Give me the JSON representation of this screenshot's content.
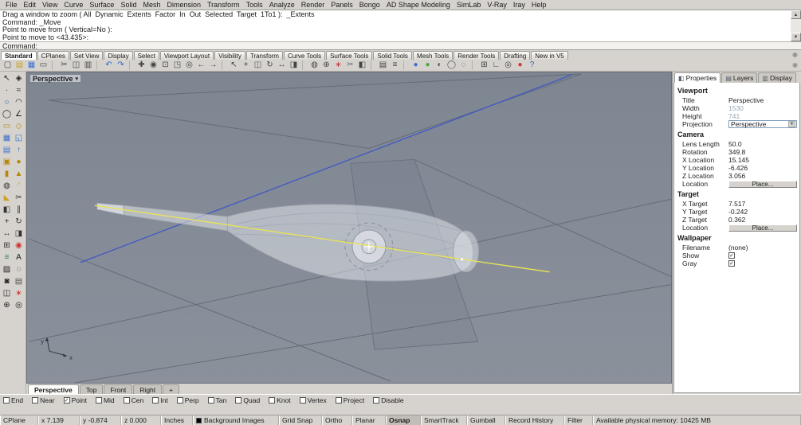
{
  "icons": {
    "dropdown": "▾",
    "check": "✓",
    "scroll_up": "▲",
    "scroll_down": "▼",
    "round_button": "◉"
  },
  "menu_bar": {
    "items": [
      "File",
      "Edit",
      "View",
      "Curve",
      "Surface",
      "Solid",
      "Mesh",
      "Dimension",
      "Transform",
      "Tools",
      "Analyze",
      "Render",
      "Panels",
      "Bongo",
      "AD Shape Modeling",
      "SimLab",
      "V-Ray",
      "Iray",
      "Help"
    ]
  },
  "command_area": {
    "history": [
      "Drag a window to zoom ( All  Dynamic  Extents  Factor  In  Out  Selected  Target  1To1 ):  _Extents",
      "Command: _Move",
      "Point to move from ( Vertical=No ):",
      "Point to move to <43.435>:"
    ],
    "prompt_label": "Command:"
  },
  "toolbar_tabs": {
    "tabs": [
      {
        "label": "Standard",
        "active": true
      },
      {
        "label": "CPlanes"
      },
      {
        "label": "Set View"
      },
      {
        "label": "Display"
      },
      {
        "label": "Select"
      },
      {
        "label": "Viewport Layout"
      },
      {
        "label": "Visibility"
      },
      {
        "label": "Transform"
      },
      {
        "label": "Curve Tools"
      },
      {
        "label": "Surface Tools"
      },
      {
        "label": "Solid Tools"
      },
      {
        "label": "Mesh Tools"
      },
      {
        "label": "Render Tools"
      },
      {
        "label": "Drafting"
      },
      {
        "label": "New in V5"
      }
    ]
  },
  "standard_toolbar": {
    "icons": [
      {
        "name": "new-file-icon",
        "glyph": "▢",
        "color": "#444"
      },
      {
        "name": "open-file-icon",
        "glyph": "▤",
        "color": "#c9a227"
      },
      {
        "name": "save-icon",
        "glyph": "▦",
        "color": "#3a6fd0"
      },
      {
        "name": "print-icon",
        "glyph": "▭",
        "color": "#444"
      },
      {
        "sep": true
      },
      {
        "name": "cut-icon",
        "glyph": "✂",
        "color": "#444"
      },
      {
        "name": "copy-icon",
        "glyph": "◫",
        "color": "#444"
      },
      {
        "name": "paste-icon",
        "glyph": "▥",
        "color": "#444"
      },
      {
        "sep": true
      },
      {
        "name": "undo-icon",
        "glyph": "↶",
        "color": "#2a62c9"
      },
      {
        "name": "redo-icon",
        "glyph": "↷",
        "color": "#2a62c9"
      },
      {
        "sep": true
      },
      {
        "name": "pan-view-icon",
        "glyph": "✚",
        "color": "#444"
      },
      {
        "name": "zoom-dynamic-icon",
        "glyph": "◉",
        "color": "#444"
      },
      {
        "name": "zoom-window-icon",
        "glyph": "⊡",
        "color": "#444"
      },
      {
        "name": "zoom-extents-icon",
        "glyph": "◳",
        "color": "#444"
      },
      {
        "name": "zoom-selected-icon",
        "glyph": "◎",
        "color": "#444"
      },
      {
        "name": "undo-view-icon",
        "glyph": "←",
        "color": "#444"
      },
      {
        "name": "redo-view-icon",
        "glyph": "→",
        "color": "#444"
      },
      {
        "sep": true
      },
      {
        "name": "select-objects-icon",
        "glyph": "↖",
        "color": "#444"
      },
      {
        "name": "move-object-icon",
        "glyph": "+",
        "color": "#444"
      },
      {
        "name": "copy-object-icon",
        "glyph": "◫",
        "color": "#555"
      },
      {
        "name": "rotate-object-icon",
        "glyph": "↻",
        "color": "#444"
      },
      {
        "name": "scale-object-icon",
        "glyph": "↔",
        "color": "#444"
      },
      {
        "name": "mirror-object-icon",
        "glyph": "◨",
        "color": "#444"
      },
      {
        "sep": true
      },
      {
        "name": "curve-boolean-icon",
        "glyph": "◍",
        "color": "#444"
      },
      {
        "name": "join-icon",
        "glyph": "⊕",
        "color": "#444"
      },
      {
        "name": "explode-icon",
        "glyph": "∗",
        "color": "#c33"
      },
      {
        "name": "trim-icon",
        "glyph": "✂",
        "color": "#666"
      },
      {
        "name": "split-icon",
        "glyph": "◧",
        "color": "#444"
      },
      {
        "sep": true
      },
      {
        "name": "layers-dialog-icon",
        "glyph": "▤",
        "color": "#444"
      },
      {
        "name": "object-properties-icon",
        "glyph": "≡",
        "color": "#444"
      },
      {
        "sep": true
      },
      {
        "name": "render-icon",
        "glyph": "●",
        "color": "#3a6fd0"
      },
      {
        "name": "render-preview-icon",
        "glyph": "●",
        "color": "#4aa34a"
      },
      {
        "name": "shaded-viewport-icon",
        "glyph": "◐",
        "color": "#555"
      },
      {
        "name": "wireframe-viewport-icon",
        "glyph": "◯",
        "color": "#555"
      },
      {
        "name": "ghosted-viewport-icon",
        "glyph": "◌",
        "color": "#555"
      },
      {
        "sep": true
      },
      {
        "name": "grid-snap-icon",
        "glyph": "⊞",
        "color": "#444"
      },
      {
        "name": "ortho-icon",
        "glyph": "∟",
        "color": "#444"
      },
      {
        "name": "osnap-toggle-icon",
        "glyph": "◎",
        "color": "#444"
      },
      {
        "name": "record-history-icon",
        "glyph": "●",
        "color": "#c33"
      },
      {
        "name": "help-icon",
        "glyph": "?",
        "color": "#2a62c9"
      }
    ]
  },
  "side_toolbar": {
    "icons": [
      {
        "name": "select-arrow-icon",
        "glyph": "↖",
        "color": "#222"
      },
      {
        "name": "selection-filter-icon",
        "glyph": "◈",
        "color": "#222"
      },
      {
        "name": "point-icon",
        "glyph": "∙",
        "color": "#222"
      },
      {
        "name": "curve-icon",
        "glyph": "≈",
        "color": "#222"
      },
      {
        "name": "circle-icon",
        "glyph": "○",
        "color": "#1a56b0"
      },
      {
        "name": "arc-icon",
        "glyph": "◠",
        "color": "#222"
      },
      {
        "name": "ellipse-icon",
        "glyph": "◯",
        "color": "#222"
      },
      {
        "name": "polyline-icon",
        "glyph": "∠",
        "color": "#222"
      },
      {
        "name": "rectangle-icon",
        "glyph": "▭",
        "color": "#b8860b"
      },
      {
        "name": "polygon-icon",
        "glyph": "◇",
        "color": "#b8860b"
      },
      {
        "name": "surface-plane-icon",
        "glyph": "▦",
        "color": "#3a6fd0"
      },
      {
        "name": "surface-corner-icon",
        "glyph": "◱",
        "color": "#3a6fd0"
      },
      {
        "name": "loft-icon",
        "glyph": "▤",
        "color": "#3a6fd0"
      },
      {
        "name": "extrude-icon",
        "glyph": "↑",
        "color": "#3a6fd0"
      },
      {
        "name": "box-icon",
        "glyph": "▣",
        "color": "#b8860b"
      },
      {
        "name": "sphere-icon",
        "glyph": "●",
        "color": "#b8860b"
      },
      {
        "name": "cylinder-icon",
        "glyph": "▮",
        "color": "#b8860b"
      },
      {
        "name": "cone-icon",
        "glyph": "▲",
        "color": "#b8860b"
      },
      {
        "name": "boolean-union-icon",
        "glyph": "◍",
        "color": "#333"
      },
      {
        "name": "fillet-icon",
        "glyph": "◜",
        "color": "#c9a227"
      },
      {
        "name": "chamfer-icon",
        "glyph": "◣",
        "color": "#c9a227"
      },
      {
        "name": "trim-curve-icon",
        "glyph": "✂",
        "color": "#333"
      },
      {
        "name": "split-curve-icon",
        "glyph": "◧",
        "color": "#333"
      },
      {
        "name": "offset-icon",
        "glyph": "∥",
        "color": "#333"
      },
      {
        "name": "move-icon",
        "glyph": "+",
        "color": "#333"
      },
      {
        "name": "rotate-icon",
        "glyph": "↻",
        "color": "#333"
      },
      {
        "name": "scale-icon",
        "glyph": "↔",
        "color": "#333"
      },
      {
        "name": "mirror-icon",
        "glyph": "◨",
        "color": "#333"
      },
      {
        "name": "array-icon",
        "glyph": "⊞",
        "color": "#333"
      },
      {
        "name": "gumball-icon",
        "glyph": "◉",
        "color": "#c33"
      },
      {
        "name": "dimension-icon",
        "glyph": "≡",
        "color": "#2a7d4f"
      },
      {
        "name": "text-icon",
        "glyph": "A",
        "color": "#222"
      },
      {
        "name": "hatch-icon",
        "glyph": "▨",
        "color": "#222"
      },
      {
        "name": "hide-object-icon",
        "glyph": "◌",
        "color": "#222"
      },
      {
        "name": "lock-object-icon",
        "glyph": "◙",
        "color": "#222"
      },
      {
        "name": "layer-tool-icon",
        "glyph": "▤",
        "color": "#555"
      },
      {
        "name": "group-icon",
        "glyph": "◫",
        "color": "#222"
      },
      {
        "name": "explode-tool-icon",
        "glyph": "∗",
        "color": "#c33"
      },
      {
        "name": "join-tool-icon",
        "glyph": "⊕",
        "color": "#222"
      },
      {
        "name": "zoom-tool-icon",
        "glyph": "◎",
        "color": "#222"
      }
    ]
  },
  "viewport": {
    "title": "Perspective",
    "axis": {
      "x_label": "x",
      "y_label": "y"
    },
    "tabs": [
      {
        "label": "Perspective",
        "active": true
      },
      {
        "label": "Top"
      },
      {
        "label": "Front"
      },
      {
        "label": "Right"
      },
      {
        "label": "+"
      }
    ]
  },
  "properties_panel": {
    "tabs": [
      {
        "label": "Properties",
        "active": true,
        "icon": "◧"
      },
      {
        "label": "Layers",
        "icon": "▤"
      },
      {
        "label": "Display",
        "icon": "▥"
      }
    ],
    "sections": [
      {
        "title": "Viewport",
        "rows": [
          {
            "label": "Title",
            "value": "Perspective",
            "type": "text"
          },
          {
            "label": "Width",
            "value": "1530",
            "type": "muted"
          },
          {
            "label": "Height",
            "value": "741",
            "type": "muted"
          },
          {
            "label": "Projection",
            "value": "Perspective",
            "type": "select"
          }
        ]
      },
      {
        "title": "Camera",
        "rows": [
          {
            "label": "Lens Length",
            "value": "50.0",
            "type": "text"
          },
          {
            "label": "Rotation",
            "value": "349.8",
            "type": "text"
          },
          {
            "label": "X Location",
            "value": "15.145",
            "type": "text"
          },
          {
            "label": "Y Location",
            "value": "-6.426",
            "type": "text"
          },
          {
            "label": "Z Location",
            "value": "3.056",
            "type": "text"
          },
          {
            "label": "Location",
            "value": "Place...",
            "type": "button"
          }
        ]
      },
      {
        "title": "Target",
        "rows": [
          {
            "label": "X Target",
            "value": "7.517",
            "type": "text"
          },
          {
            "label": "Y Target",
            "value": "-0.242",
            "type": "text"
          },
          {
            "label": "Z Target",
            "value": "0.362",
            "type": "text"
          },
          {
            "label": "Location",
            "value": "Place...",
            "type": "button"
          }
        ]
      },
      {
        "title": "Wallpaper",
        "rows": [
          {
            "label": "Filename",
            "value": "(none)",
            "type": "text"
          },
          {
            "label": "Show",
            "type": "check",
            "checked": true
          },
          {
            "label": "Gray",
            "type": "check",
            "checked": true
          }
        ]
      }
    ]
  },
  "osnap_bar": {
    "options": [
      {
        "label": "End",
        "checked": false
      },
      {
        "label": "Near",
        "checked": false
      },
      {
        "label": "Point",
        "checked": true
      },
      {
        "label": "Mid",
        "checked": false
      },
      {
        "label": "Cen",
        "checked": false
      },
      {
        "label": "Int",
        "checked": false
      },
      {
        "label": "Perp",
        "checked": false
      },
      {
        "label": "Tan",
        "checked": false
      },
      {
        "label": "Quad",
        "checked": false
      },
      {
        "label": "Knot",
        "checked": false
      },
      {
        "label": "Vertex",
        "checked": false
      },
      {
        "label": "Project",
        "checked": false
      },
      {
        "label": "Disable",
        "checked": false
      }
    ]
  },
  "status_bar": {
    "cells": [
      {
        "label": "CPlane"
      },
      {
        "label": "x 7.139"
      },
      {
        "label": "y -0.874"
      },
      {
        "label": "z 0.000"
      },
      {
        "label": "Inches"
      },
      {
        "label": "Background Images",
        "swatch": "#000000"
      },
      {
        "label": "Grid Snap"
      },
      {
        "label": "Ortho"
      },
      {
        "label": "Planar"
      },
      {
        "label": "Osnap",
        "active": true
      },
      {
        "label": "SmartTrack"
      },
      {
        "label": "Gumball"
      },
      {
        "label": "Record History"
      },
      {
        "label": "Filter"
      },
      {
        "label": "Available physical memory: 10425 MB",
        "info": true
      }
    ]
  }
}
